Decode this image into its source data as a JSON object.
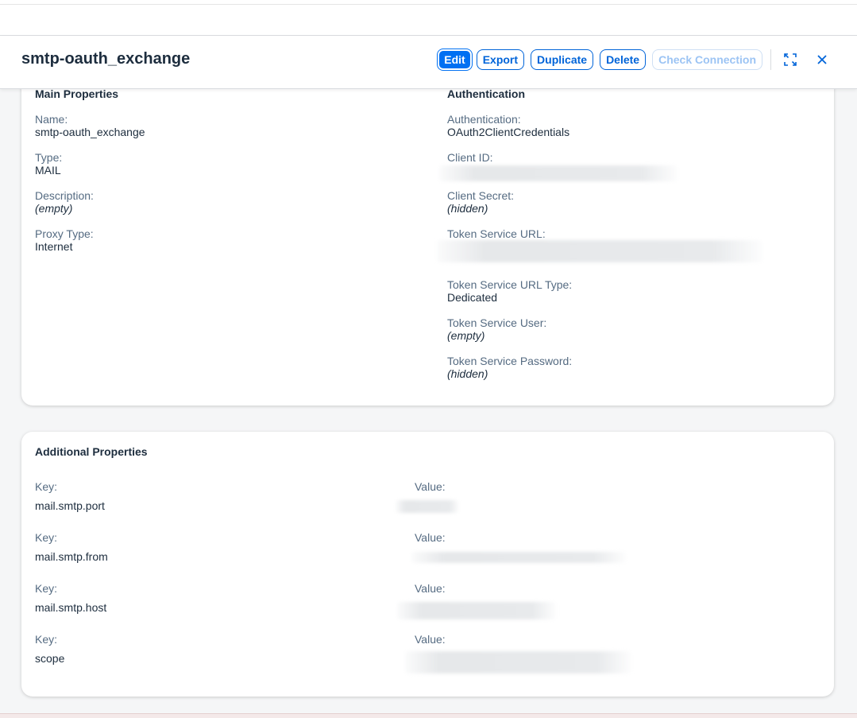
{
  "header": {
    "title": "smtp-oauth_exchange",
    "edit_label": "Edit",
    "export_label": "Export",
    "duplicate_label": "Duplicate",
    "delete_label": "Delete",
    "check_connection_label": "Check Connection",
    "expand_icon": "expand-icon",
    "close_icon": "close-icon"
  },
  "main_properties": {
    "title": "Main Properties",
    "name_label": "Name:",
    "name_value": "smtp-oauth_exchange",
    "type_label": "Type:",
    "type_value": "MAIL",
    "description_label": "Description:",
    "description_value": "(empty)",
    "proxy_type_label": "Proxy Type:",
    "proxy_type_value": "Internet"
  },
  "authentication": {
    "title": "Authentication",
    "authentication_label": "Authentication:",
    "authentication_value": "OAuth2ClientCredentials",
    "client_id_label": "Client ID:",
    "client_secret_label": "Client Secret:",
    "client_secret_value": "(hidden)",
    "token_service_url_label": "Token Service URL:",
    "token_service_url_type_label": "Token Service URL Type:",
    "token_service_url_type_value": "Dedicated",
    "token_service_user_label": "Token Service User:",
    "token_service_user_value": "(empty)",
    "token_service_password_label": "Token Service Password:",
    "token_service_password_value": "(hidden)"
  },
  "additional_properties": {
    "title": "Additional Properties",
    "key_label": "Key:",
    "value_label": "Value:",
    "rows": [
      {
        "key": "mail.smtp.port"
      },
      {
        "key": "mail.smtp.from"
      },
      {
        "key": "mail.smtp.host"
      },
      {
        "key": "scope"
      }
    ]
  },
  "colors": {
    "accent": "#0064d9",
    "primary_button": "#0070f2",
    "text": "#1d2d3e",
    "label": "#556b82"
  }
}
